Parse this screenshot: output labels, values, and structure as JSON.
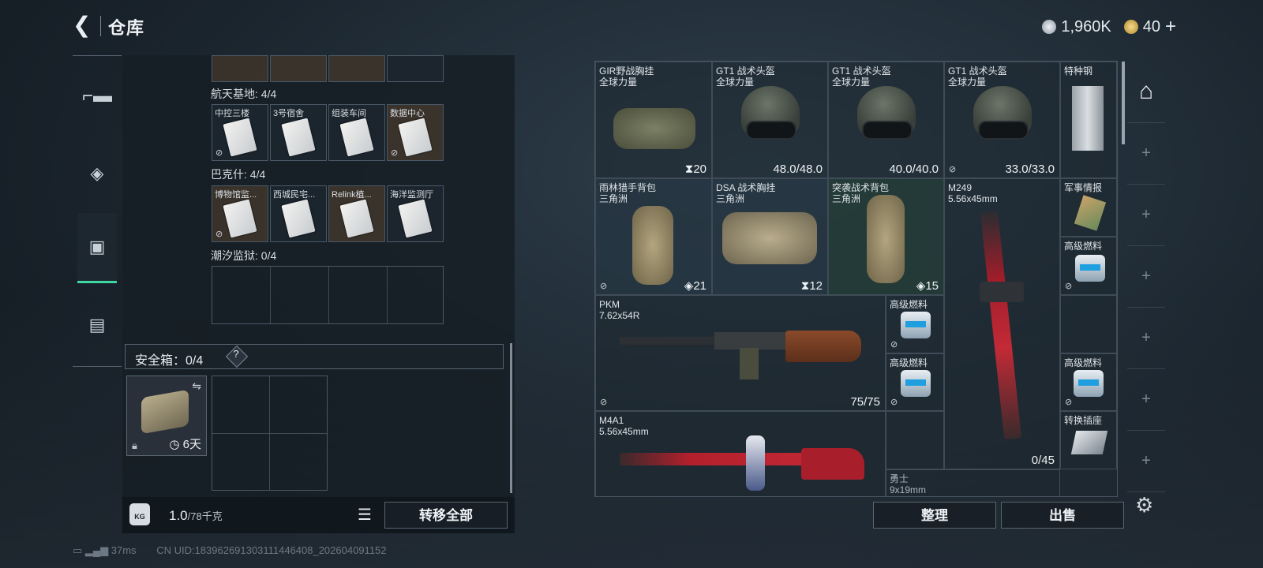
{
  "header": {
    "back_icon": "back-arrow-icon",
    "title": "仓库"
  },
  "currency": {
    "silver": "1,960K",
    "gold": "40",
    "plus": "+"
  },
  "nav": {
    "items": [
      {
        "name": "weapon-tab",
        "icon": "pistol-icon",
        "glyph": "▬"
      },
      {
        "name": "armor-tab",
        "icon": "vest-icon",
        "glyph": "◈"
      },
      {
        "name": "container-tab",
        "icon": "container-icon",
        "glyph": "▣",
        "active": true
      },
      {
        "name": "case-tab",
        "icon": "briefcase-icon",
        "glyph": "▤"
      }
    ]
  },
  "keycards": {
    "sections": [
      {
        "title": "航天基地: 4/4",
        "slots": [
          "中控三楼",
          "3号宿舍",
          "组装车间",
          "数据中心"
        ]
      },
      {
        "title": "巴克什: 4/4",
        "slots": [
          "博物馆监...",
          "西城民宅...",
          "Relink植...",
          "海洋监测厅"
        ]
      },
      {
        "title": "潮汐监狱: 0/4",
        "slots": []
      }
    ]
  },
  "safebox": {
    "label": "安全箱：0/4",
    "help": "?",
    "duration": "6天"
  },
  "footer": {
    "weight": "1.0",
    "weight_cap": "/78千克",
    "transfer_all": "转移全部",
    "sort": "整理",
    "sell": "出售"
  },
  "grid_items": {
    "gir": {
      "name": "GIR野战胸挂",
      "sub": "全球力量",
      "value": "20"
    },
    "gt1a": {
      "name": "GT1 战术头盔",
      "sub": "全球力量",
      "value": "48.0/48.0"
    },
    "gt1b": {
      "name": "GT1 战术头盔",
      "sub": "全球力量",
      "value": "40.0/40.0"
    },
    "gt1c": {
      "name": "GT1 战术头盔",
      "sub": "全球力量",
      "value": "33.0/33.0"
    },
    "steel": {
      "name": "特种钢"
    },
    "rainforest": {
      "name": "雨林猎手背包",
      "sub": "三角洲",
      "value": "21"
    },
    "dsa": {
      "name": "DSA 战术胸挂",
      "sub": "三角洲",
      "value": "12"
    },
    "assault": {
      "name": "突袭战术背包",
      "sub": "三角洲",
      "value": "15"
    },
    "m249": {
      "name": "M249",
      "sub": "5.56x45mm",
      "value": "0/45"
    },
    "intel": {
      "name": "军事情报"
    },
    "fuel1": {
      "name": "高级燃料"
    },
    "pkm": {
      "name": "PKM",
      "sub": "7.62x54R",
      "value": "75/75"
    },
    "fuel2": {
      "name": "高级燃料"
    },
    "fuel3": {
      "name": "高级燃料"
    },
    "fuel4": {
      "name": "高级燃料"
    },
    "socket": {
      "name": "转换插座"
    },
    "m4a1": {
      "name": "M4A1",
      "sub": "5.56x45mm"
    },
    "warrior": {
      "name": "勇士",
      "sub": "9x19mm"
    }
  },
  "status": {
    "ping": "37ms",
    "uid": "CN UID:18396269130311144640​8_202604091152"
  },
  "colors": {
    "accent": "#3fd6a2",
    "weapon_red": "#b3202c"
  }
}
